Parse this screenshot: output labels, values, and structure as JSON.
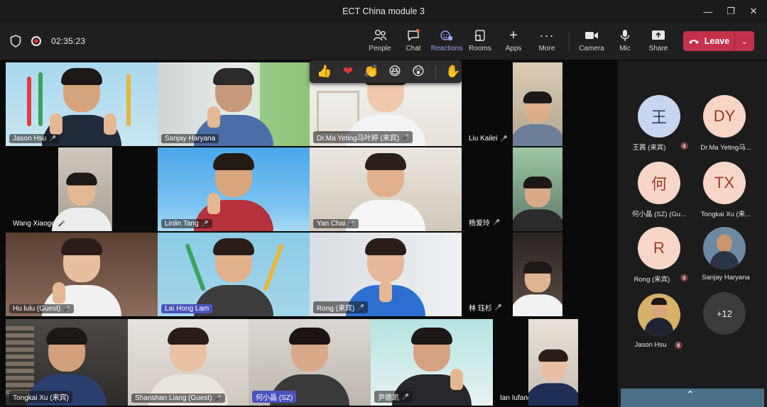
{
  "window": {
    "title": "ECT China module 3"
  },
  "meeting": {
    "elapsed": "02:35:23"
  },
  "toolbar": {
    "people": "People",
    "chat": "Chat",
    "reactions": "Reactions",
    "rooms": "Rooms",
    "apps": "Apps",
    "more": "More",
    "camera": "Camera",
    "mic": "Mic",
    "share": "Share",
    "leave": "Leave"
  },
  "reactions": [
    "like",
    "heart",
    "applause",
    "laugh",
    "surprised",
    "raise-hand"
  ],
  "tiles": [
    {
      "name": "Jason Hsu"
    },
    {
      "name": "Sanjay Haryana"
    },
    {
      "name": "Dr.Ma Yeting马叶婷 (来宾)"
    },
    {
      "name": "Liu Kailei"
    },
    {
      "name": "Wang Xiaoge"
    },
    {
      "name": "Linlin Tang"
    },
    {
      "name": "Yan Chai"
    },
    {
      "name": "杨爱玲"
    },
    {
      "name": "Hu lulu (Guest)"
    },
    {
      "name": "Lai Hong Lam"
    },
    {
      "name": "Rong (来宾)"
    },
    {
      "name": "林 珏杉"
    },
    {
      "name": "Tongkai Xu (来宾)"
    },
    {
      "name": "Shanshan Liang (Guest)"
    },
    {
      "name": "何小晶 (SZ)"
    },
    {
      "name": "尹德凯"
    },
    {
      "name": "Ian Iufang"
    }
  ],
  "roster": [
    {
      "initials": "王",
      "name": "王茜 (来宾)"
    },
    {
      "initials": "DY",
      "name": "Dr.Ma Yeting马..."
    },
    {
      "initials": "何",
      "name": "何小晶 (SZ) (Gu..."
    },
    {
      "initials": "TX",
      "name": "Tongkai Xu (来..."
    },
    {
      "initials": "R",
      "name": "Rong (来宾)"
    },
    {
      "initials": "",
      "name": "Sanjay Haryana"
    },
    {
      "initials": "",
      "name": "Jason Hsu"
    }
  ],
  "overflow": "+12"
}
